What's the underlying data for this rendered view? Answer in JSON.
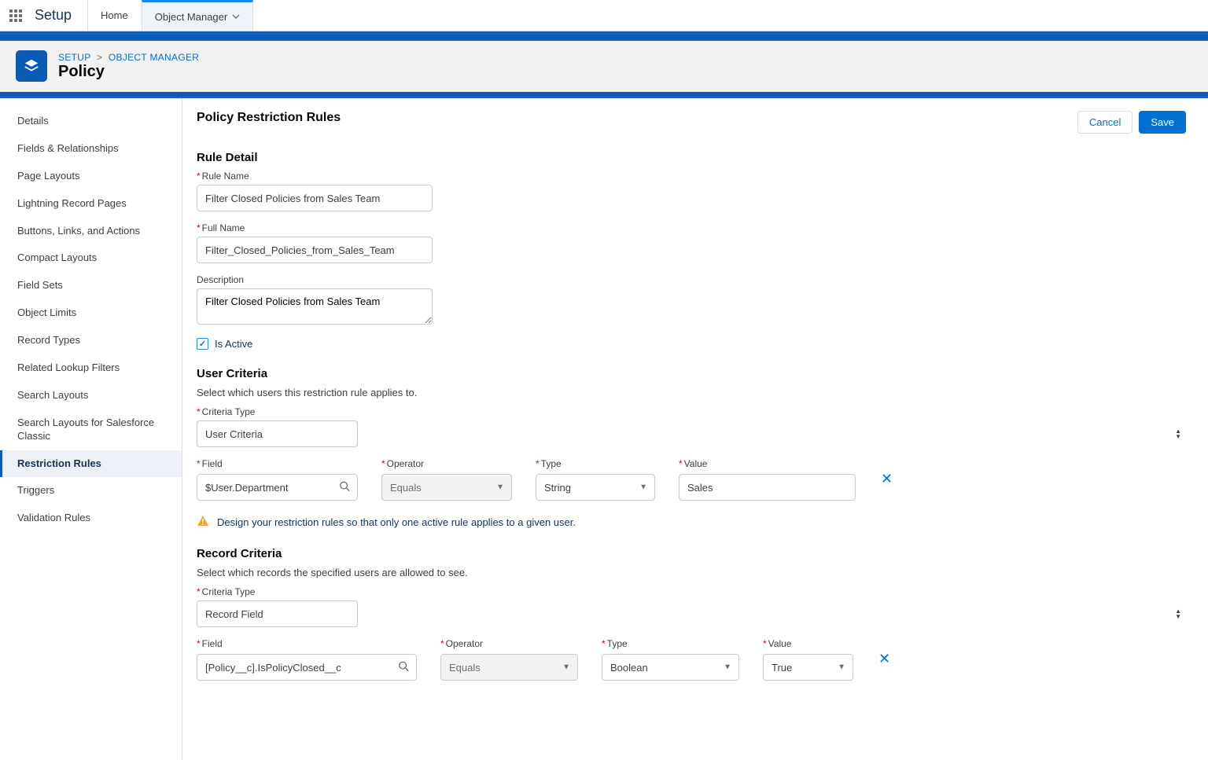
{
  "topbar": {
    "app_name": "Setup",
    "tabs": [
      {
        "label": "Home",
        "active": false
      },
      {
        "label": "Object Manager",
        "active": true
      }
    ]
  },
  "header": {
    "breadcrumb_setup": "SETUP",
    "breadcrumb_object_manager": "OBJECT MANAGER",
    "title": "Policy"
  },
  "sidebar": {
    "items": [
      "Details",
      "Fields & Relationships",
      "Page Layouts",
      "Lightning Record Pages",
      "Buttons, Links, and Actions",
      "Compact Layouts",
      "Field Sets",
      "Object Limits",
      "Record Types",
      "Related Lookup Filters",
      "Search Layouts",
      "Search Layouts for Salesforce Classic",
      "Restriction Rules",
      "Triggers",
      "Validation Rules"
    ],
    "active_index": 12
  },
  "main": {
    "title": "Policy Restriction Rules",
    "cancel_label": "Cancel",
    "save_label": "Save",
    "rule_detail": {
      "heading": "Rule Detail",
      "rule_name_label": "Rule Name",
      "rule_name_value": "Filter Closed Policies from Sales Team",
      "full_name_label": "Full Name",
      "full_name_value": "Filter_Closed_Policies_from_Sales_Team",
      "description_label": "Description",
      "description_value": "Filter Closed Policies from Sales Team",
      "is_active_label": "Is Active",
      "is_active_checked": true
    },
    "user_criteria": {
      "heading": "User Criteria",
      "sub": "Select which users this restriction rule applies to.",
      "criteria_type_label": "Criteria Type",
      "criteria_type_value": "User Criteria",
      "field_label": "Field",
      "field_value": "$User.Department",
      "operator_label": "Operator",
      "operator_value": "Equals",
      "type_label": "Type",
      "type_value": "String",
      "value_label": "Value",
      "value_value": "Sales",
      "warning_text": "Design your restriction rules so that only one active rule applies to a given user."
    },
    "record_criteria": {
      "heading": "Record Criteria",
      "sub": "Select which records the specified users are allowed to see.",
      "criteria_type_label": "Criteria Type",
      "criteria_type_value": "Record Field",
      "field_label": "Field",
      "field_value": "[Policy__c].IsPolicyClosed__c",
      "operator_label": "Operator",
      "operator_value": "Equals",
      "type_label": "Type",
      "type_value": "Boolean",
      "value_label": "Value",
      "value_value": "True"
    }
  }
}
